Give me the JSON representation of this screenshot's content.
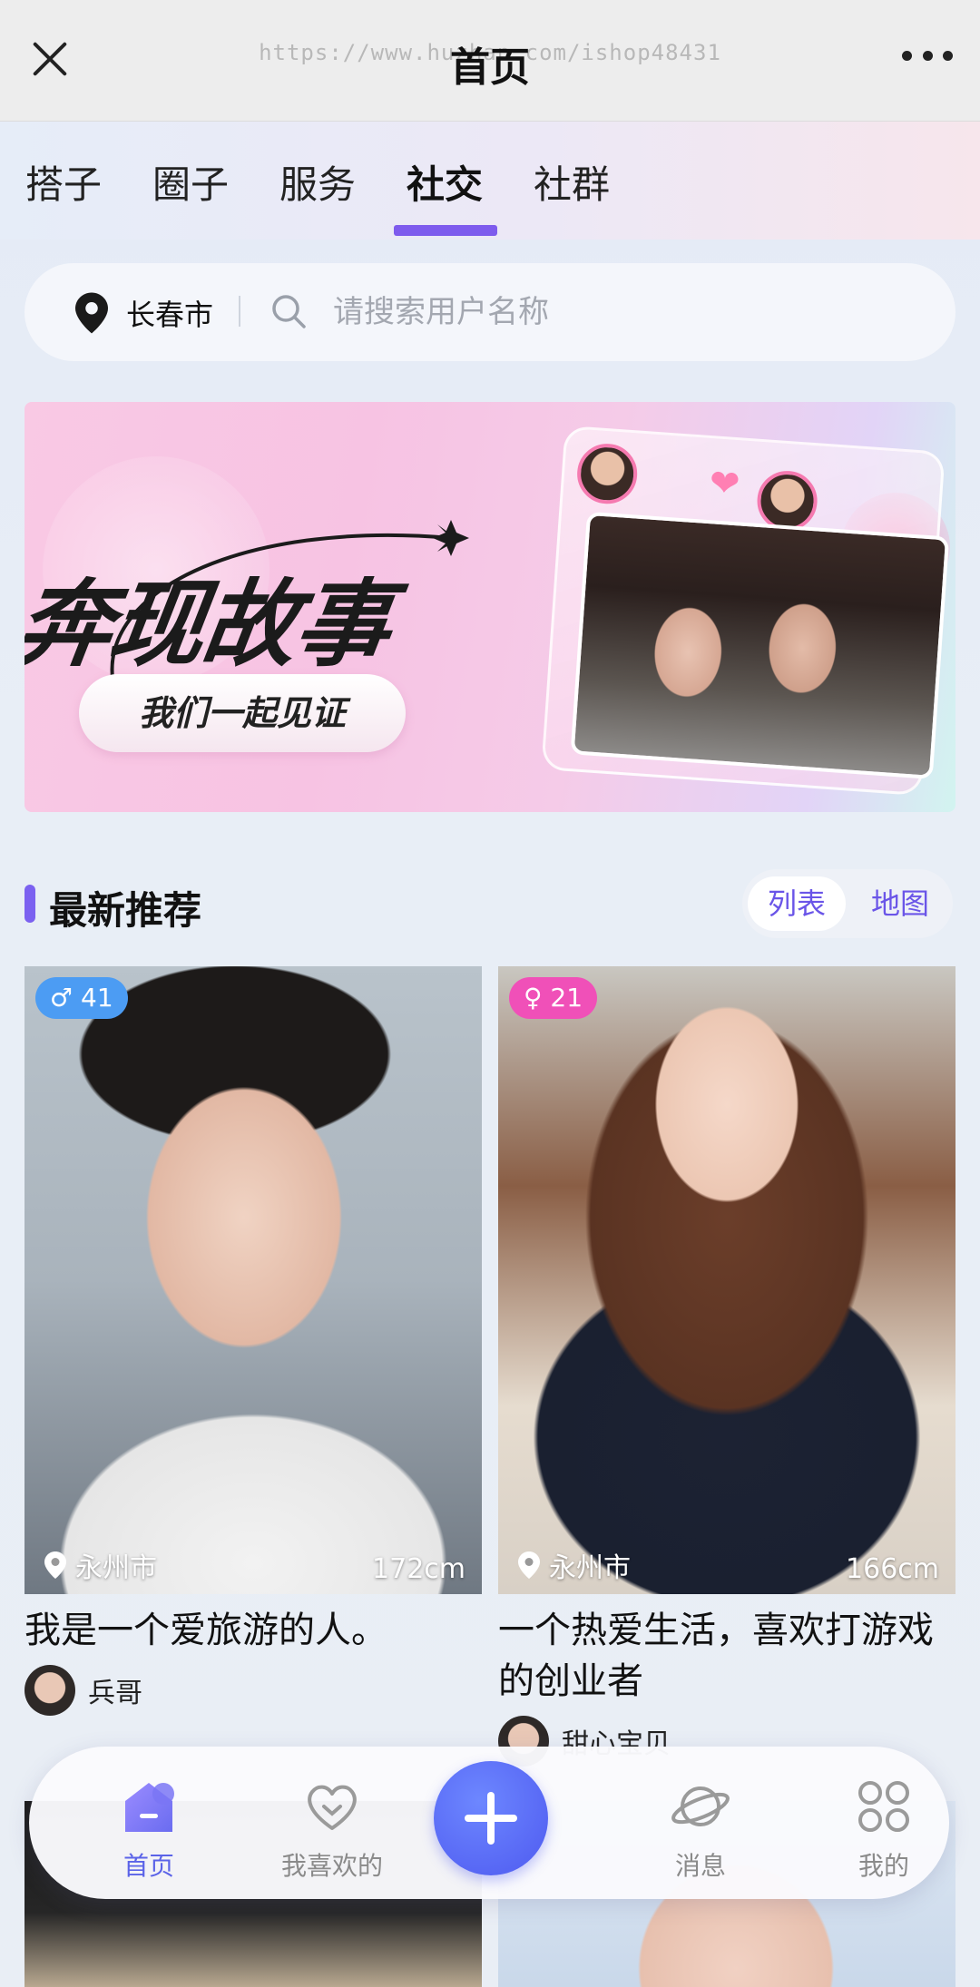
{
  "header": {
    "title": "首页",
    "watermark": "https://www.huzhan.com/ishop48431"
  },
  "tabs": [
    {
      "label": "搭子",
      "active": false
    },
    {
      "label": "圈子",
      "active": false
    },
    {
      "label": "服务",
      "active": false
    },
    {
      "label": "社交",
      "active": true
    },
    {
      "label": "社群",
      "active": false
    }
  ],
  "search": {
    "city": "长春市",
    "placeholder": "请搜索用户名称"
  },
  "banner": {
    "title": "奔现故事",
    "subtitle": "我们一起见证"
  },
  "section": {
    "title": "最新推荐",
    "view_options": [
      "列表",
      "地图"
    ],
    "active_view": "列表"
  },
  "cards": [
    {
      "gender_symbol": "♂",
      "age": "41",
      "city": "永州市",
      "height": "172cm",
      "description": "我是一个爱旅游的人。",
      "username": "兵哥"
    },
    {
      "gender_symbol": "♀",
      "age": "21",
      "city": "永州市",
      "height": "166cm",
      "description": "一个热爱生活，喜欢打游戏的创业者",
      "username": "甜心宝贝"
    }
  ],
  "bottom_nav": {
    "items": [
      {
        "label": "首页",
        "icon": "home-icon",
        "active": true
      },
      {
        "label": "我喜欢的",
        "icon": "heart-icon",
        "active": false
      },
      {
        "label": "消息",
        "icon": "planet-icon",
        "active": false
      },
      {
        "label": "我的",
        "icon": "grid-icon",
        "active": false
      }
    ],
    "add_icon": "plus-icon"
  },
  "colors": {
    "accent": "#7b61f0",
    "male_badge": "#4c9cf3",
    "female_badge": "#f050b8",
    "nav_active": "#5b63e8"
  }
}
